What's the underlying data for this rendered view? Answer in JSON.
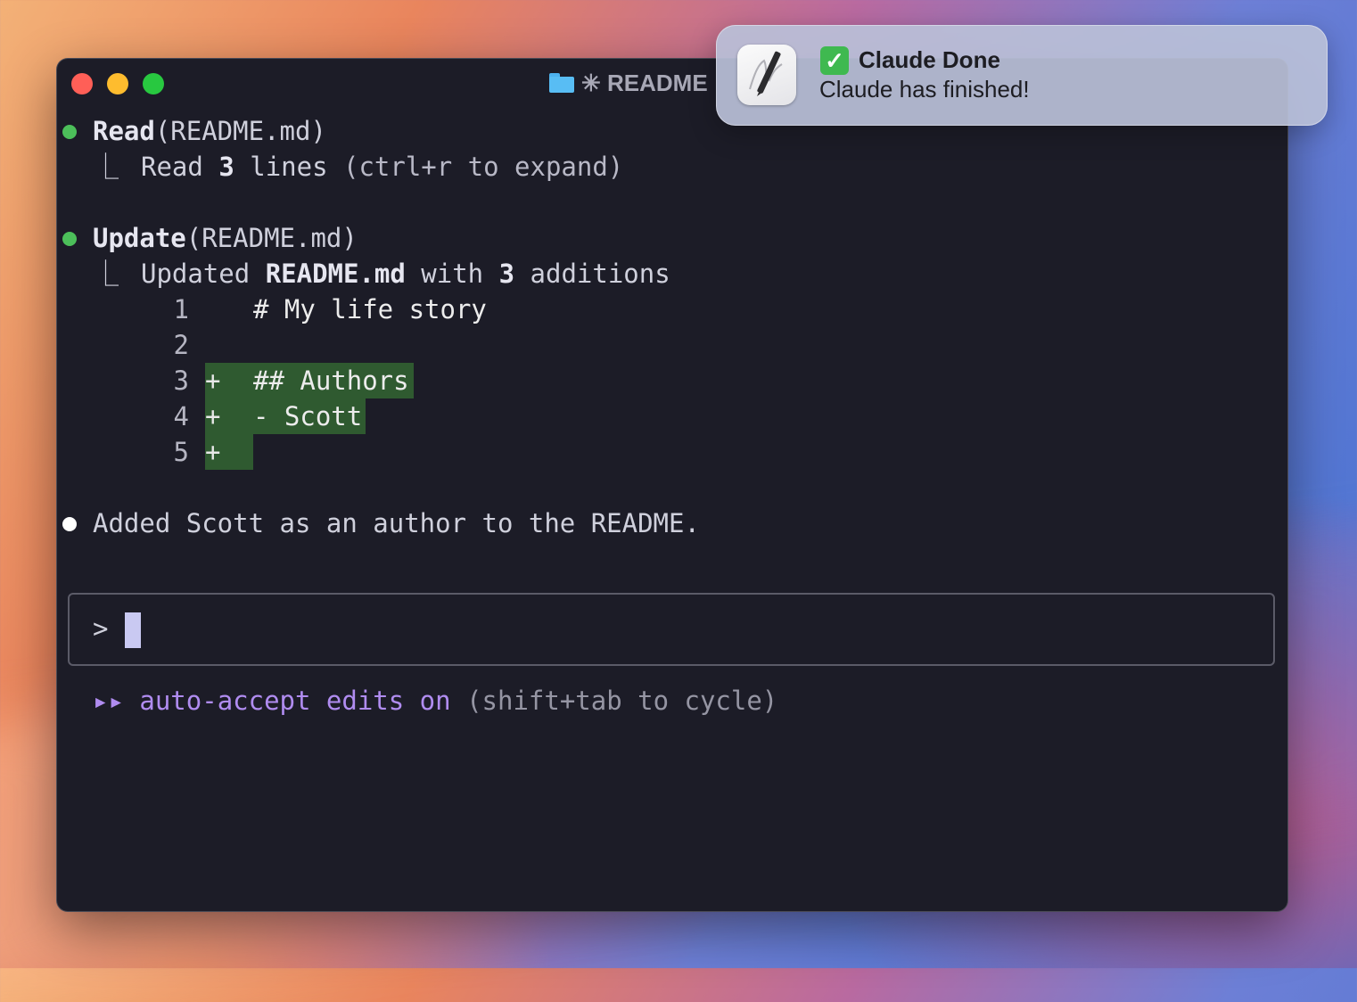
{
  "window": {
    "title": "✳ README"
  },
  "transcript": {
    "read": {
      "tool": "Read",
      "arg": "(README.md)",
      "result_prefix": "Read ",
      "result_count": "3",
      "result_suffix": " lines ",
      "result_hint": "(ctrl+r to expand)"
    },
    "update": {
      "tool": "Update",
      "arg": "(README.md)",
      "result_prefix": "Updated ",
      "result_file": "README.md",
      "result_mid": " with ",
      "result_count": "3",
      "result_suffix": " additions",
      "diff": [
        {
          "num": "1",
          "marker": "",
          "code": "# My life story"
        },
        {
          "num": "2",
          "marker": "",
          "code": ""
        },
        {
          "num": "3",
          "marker": "+",
          "code": "## Authors"
        },
        {
          "num": "4",
          "marker": "+",
          "code": "- Scott"
        },
        {
          "num": "5",
          "marker": "+",
          "code": ""
        }
      ]
    },
    "message": "Added Scott as an author to the README."
  },
  "tree_glyph": "⎿",
  "input": {
    "prompt": ">"
  },
  "mode": {
    "icon": "▸▸",
    "text": "auto-accept edits on",
    "hint": "(shift+tab to cycle)"
  },
  "notification": {
    "title": "Claude Done",
    "body": "Claude has finished!",
    "check": "✓"
  }
}
